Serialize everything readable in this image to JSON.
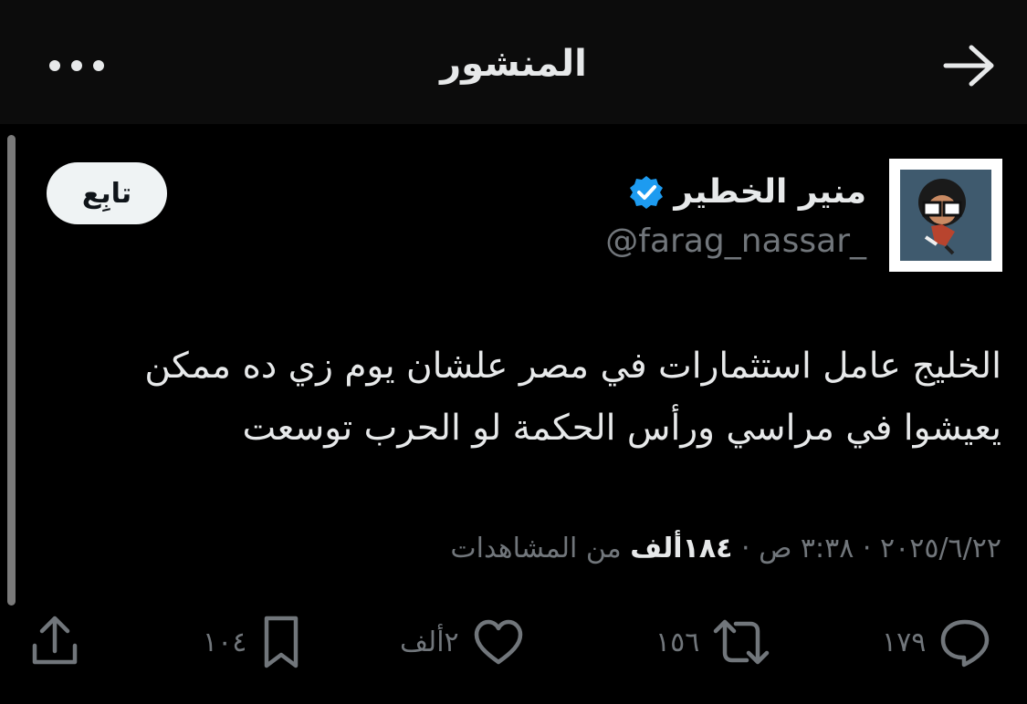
{
  "header": {
    "title": "المنشور"
  },
  "author": {
    "name": "منير الخطير",
    "handle": "@farag_nassar_"
  },
  "follow_label": "تابِع",
  "post": {
    "text": "الخليج عامل استثمارات في مصر علشان يوم زي ده ممكن يعيشوا في مراسي ورأس الحكمة لو الحرب توسعت"
  },
  "meta": {
    "date": "٢٠٢٥/٦/٢٢",
    "separator": " · ",
    "time": "٣:٣٨ ص",
    "views_count": "١٨٤ألف",
    "views_label": " من المشاهدات"
  },
  "actions": {
    "replies": "١٧٩",
    "reposts": "١٥٦",
    "likes": "٢ألف",
    "bookmarks": "١٠٤"
  },
  "colors": {
    "background": "#000000",
    "header_bg": "#0c0c0c",
    "text": "#e7e9ea",
    "muted": "#71767b",
    "verified": "#1d9bf0"
  }
}
